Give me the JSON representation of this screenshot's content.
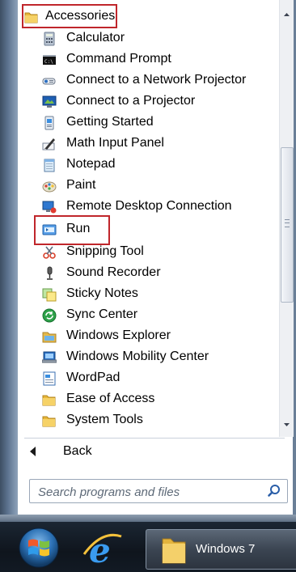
{
  "programs": {
    "folder_label": "Accessories",
    "items": [
      {
        "label": "Calculator",
        "icon": "calculator-icon"
      },
      {
        "label": "Command Prompt",
        "icon": "command-prompt-icon"
      },
      {
        "label": "Connect to a Network Projector",
        "icon": "network-projector-icon"
      },
      {
        "label": "Connect to a Projector",
        "icon": "projector-icon"
      },
      {
        "label": "Getting Started",
        "icon": "getting-started-icon"
      },
      {
        "label": "Math Input Panel",
        "icon": "math-input-icon"
      },
      {
        "label": "Notepad",
        "icon": "notepad-icon"
      },
      {
        "label": "Paint",
        "icon": "paint-icon"
      },
      {
        "label": "Remote Desktop Connection",
        "icon": "remote-desktop-icon"
      },
      {
        "label": "Run",
        "icon": "run-icon"
      },
      {
        "label": "Snipping Tool",
        "icon": "snipping-tool-icon"
      },
      {
        "label": "Sound Recorder",
        "icon": "microphone-icon"
      },
      {
        "label": "Sticky Notes",
        "icon": "sticky-notes-icon"
      },
      {
        "label": "Sync Center",
        "icon": "sync-icon"
      },
      {
        "label": "Windows Explorer",
        "icon": "folder-explorer-icon"
      },
      {
        "label": "Windows Mobility Center",
        "icon": "mobility-center-icon"
      },
      {
        "label": "WordPad",
        "icon": "wordpad-icon"
      },
      {
        "label": "Ease of Access",
        "icon": "folder-icon"
      },
      {
        "label": "System Tools",
        "icon": "folder-icon"
      }
    ]
  },
  "nav": {
    "back_label": "Back"
  },
  "search": {
    "placeholder": "Search programs and files"
  },
  "taskbar": {
    "window_label": "Windows 7"
  },
  "colors": {
    "highlight_border": "#c0262b",
    "taskbar": "#121a24"
  }
}
